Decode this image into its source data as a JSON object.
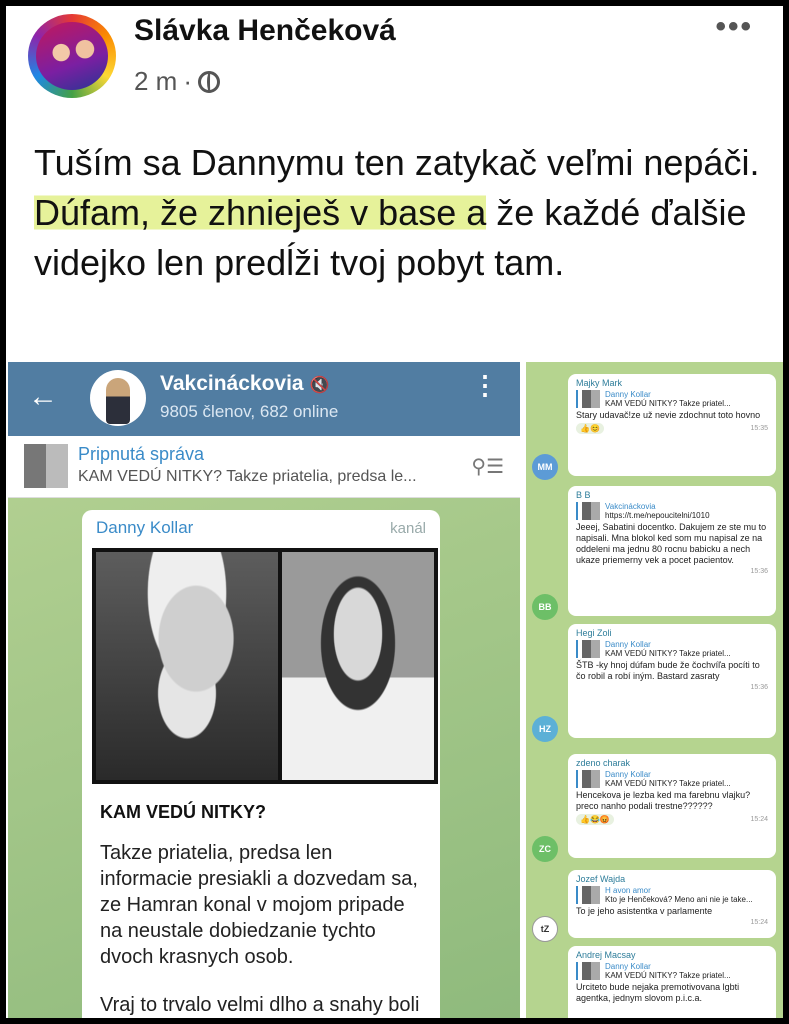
{
  "post": {
    "author": "Slávka Henčeková",
    "time": "2 m",
    "dot": "·",
    "more": "•••",
    "text_before": "Tuším sa Dannymu ten zatykač veľmi nepáči. ",
    "text_highlight": "Dúfam, že zhnieješ v base a",
    "text_after": " že každé ďalšie videjko len predĺži tvoj pobyt tam."
  },
  "telegram_left": {
    "back": "←",
    "channel": "Vakcináckovia",
    "muted": "🔇",
    "members": "9805 členov, 682 online",
    "menu": "⋮",
    "pinned_title": "Pripnutá správa",
    "pinned_text": "KAM VEDÚ NITKY?  Takze priatelia, predsa le...",
    "pinned_icon": "⚲☰",
    "message": {
      "author": "Danny Kollar",
      "channel_label": "kanál",
      "headline": "KAM VEDÚ NITKY?",
      "para1": "Takze priatelia, predsa len informacie presiakli a dozvedam sa, ze Hamran konal v mojom pripade na neustale dobiedzanie tychto dvoch krasnych osob.",
      "para2": "Vraj to trvalo velmi dlho a snahy boli ukrutne, vraj to trvalo od"
    }
  },
  "telegram_right": {
    "messages": [
      {
        "name": "Majky Mark",
        "quote_name": "Danny Kollar",
        "quote_text": "KAM VEDÚ NITKY? Takze priatel...",
        "text": "Stary udavač!ze už nevie zdochnut toto hovno",
        "reactions": "👍😊",
        "time": "15:35",
        "initials": "MM",
        "color": "#5c9bd6"
      },
      {
        "name": "B B",
        "quote_name": "Vakcináckovia",
        "quote_text": "https://t.me/nepoucitelni/1010",
        "text": "Jeeej, Sabatini docentko. Dakujem ze ste mu to napisali. Mna blokol ked som mu napisal ze na oddeleni ma jednu 80 rocnu babicku a nech ukaze priemerny vek a pocet pacientov.",
        "reactions": "",
        "time": "15:36",
        "initials": "BB",
        "color": "#6dbf67"
      },
      {
        "name": "Hegi Zoli",
        "quote_name": "Danny Kollar",
        "quote_text": "KAM VEDÚ NITKY? Takze priatel...",
        "text": "ŠTB -ky hnoj dúfam bude že čochvíľa pocíti to čo robil a robí iným. Bastard zasraty",
        "reactions": "",
        "time": "15:36",
        "initials": "HZ",
        "color": "#5cb0d6"
      },
      {
        "name": "zdeno charak",
        "quote_name": "Danny Kollar",
        "quote_text": "KAM VEDÚ NITKY? Takze priatel...",
        "text": "Hencekova je lezba ked ma farebnu vlajku? preco nanho podali trestne??????",
        "reactions": "👍😂😡",
        "time": "15:24",
        "initials": "ZC",
        "color": "#6dbf67"
      },
      {
        "name": "Jozef Wajda",
        "quote_name": "H avon amor",
        "quote_text": "Kto je Henčeková? Meno ani nie je take...",
        "text": "To je jeho asistentka v parlamente",
        "reactions": "",
        "time": "15:24",
        "initials": "tZ",
        "color": "#ffffff"
      },
      {
        "name": "Andrej Macsay",
        "quote_name": "Danny Kollar",
        "quote_text": "KAM VEDÚ NITKY? Takze priatel...",
        "text": "Urciteto bude nejaka premotivovana lgbti agentka, jednym slovom p.i.c.a.",
        "reactions": "",
        "time": "",
        "initials": "",
        "color": "#6dbf67"
      }
    ]
  }
}
